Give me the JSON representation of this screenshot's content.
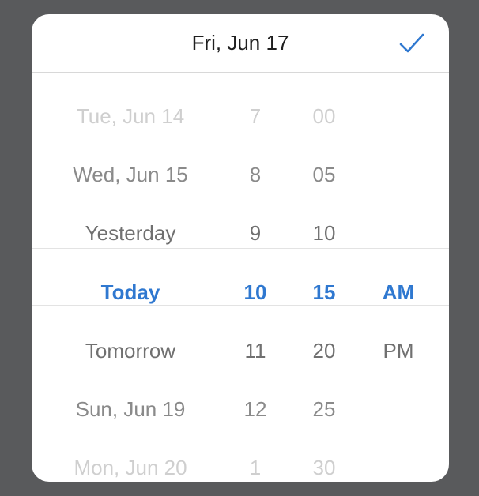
{
  "header": {
    "title": "Fri, Jun 17",
    "confirm_icon": "checkmark-icon",
    "accent_color": "#2f78d0"
  },
  "picker": {
    "dates": [
      "Tue, Jun 14",
      "Wed, Jun 15",
      "Yesterday",
      "Today",
      "Tomorrow",
      "Sun, Jun 19",
      "Mon, Jun 20"
    ],
    "hours": [
      "7",
      "8",
      "9",
      "10",
      "11",
      "12",
      "1"
    ],
    "minutes": [
      "00",
      "05",
      "10",
      "15",
      "20",
      "25",
      "30"
    ],
    "periods": [
      "AM",
      "PM"
    ],
    "selected": {
      "date": "Today",
      "hour": "10",
      "minute": "15",
      "period": "AM"
    }
  }
}
